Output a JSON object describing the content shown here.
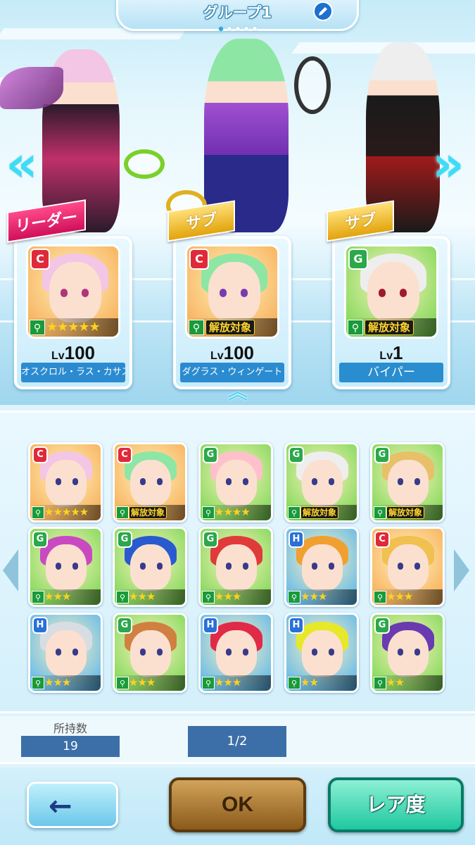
{
  "header": {
    "group_title": "グループ1",
    "page_dots": 5,
    "active_dot": 0
  },
  "party": [
    {
      "role": "リーダー",
      "rank": "C",
      "level_prefix": "Lv",
      "level": "100",
      "name": "オスクロル・ラス・カサス",
      "stars": "★★★★★",
      "tag": "",
      "hair_color": "#f2c6e4",
      "eye_color": "#b0367a",
      "bg": "#f6a64a"
    },
    {
      "role": "サブ",
      "rank": "C",
      "level_prefix": "Lv",
      "level": "100",
      "name": "ダグラス・ウィンゲート",
      "stars": "",
      "tag": "解放対象",
      "hair_color": "#8ee6a4",
      "eye_color": "#7a3ab0",
      "bg": "#f6a64a"
    },
    {
      "role": "サブ",
      "rank": "G",
      "level_prefix": "Lv",
      "level": "1",
      "name": "バイパー",
      "stars": "",
      "tag": "解放対象",
      "hair_color": "#eeeeee",
      "eye_color": "#a01a2a",
      "bg": "#6ed44a"
    }
  ],
  "roster": [
    {
      "rank": "C",
      "stars": "★★★★★",
      "tag": "",
      "hair": "#f2c6e4",
      "bg": "#f6a64a"
    },
    {
      "rank": "C",
      "stars": "",
      "tag": "解放対象",
      "hair": "#8ee6a4",
      "bg": "#f6a64a"
    },
    {
      "rank": "G",
      "stars": "★★★★",
      "tag": "",
      "hair": "#ffc0cc",
      "bg": "#6ed44a"
    },
    {
      "rank": "G",
      "stars": "",
      "tag": "解放対象",
      "hair": "#eeeeee",
      "bg": "#6ed44a"
    },
    {
      "rank": "G",
      "stars": "",
      "tag": "解放対象",
      "hair": "#e8c06a",
      "bg": "#6ed44a"
    },
    {
      "rank": "G",
      "stars": "★★★",
      "tag": "",
      "hair": "#c94ac0",
      "bg": "#6ed44a"
    },
    {
      "rank": "G",
      "stars": "★★★",
      "tag": "",
      "hair": "#2a5ad0",
      "bg": "#6ed44a"
    },
    {
      "rank": "G",
      "stars": "★★★",
      "tag": "",
      "hair": "#e03a3a",
      "bg": "#6ed44a"
    },
    {
      "rank": "H",
      "stars": "★★★",
      "tag": "",
      "hair": "#f0a030",
      "bg": "#4ab0f0"
    },
    {
      "rank": "C",
      "stars": "★★★",
      "tag": "",
      "hair": "#f0c050",
      "bg": "#f6a64a"
    },
    {
      "rank": "H",
      "stars": "★★★",
      "tag": "",
      "hair": "#d8dde4",
      "bg": "#4ab0f0"
    },
    {
      "rank": "G",
      "stars": "★★★",
      "tag": "",
      "hair": "#d08040",
      "bg": "#6ed44a"
    },
    {
      "rank": "H",
      "stars": "★★★",
      "tag": "",
      "hair": "#e02a48",
      "bg": "#4ab0f0"
    },
    {
      "rank": "H",
      "stars": "★★",
      "tag": "",
      "hair": "#e8e82a",
      "bg": "#4ab0f0"
    },
    {
      "rank": "G",
      "stars": "★★",
      "tag": "",
      "hair": "#6a3ab0",
      "bg": "#6ed44a"
    }
  ],
  "counts": {
    "owned_label": "所持数",
    "owned_value": "19",
    "page": "1/2"
  },
  "buttons": {
    "back_icon": "←",
    "ok": "OK",
    "rarity": "レア度"
  },
  "icons": {
    "edit": "pencil-icon",
    "prev": "«",
    "next": "»",
    "collapse": "︽",
    "list_left": "‹",
    "list_right": "›"
  },
  "colors": {
    "rank_C": "#e02a3a",
    "rank_G": "#2aa84a",
    "rank_H": "#2a70d8",
    "star": "#ffd21e",
    "name_box": "#2b8bd0"
  }
}
